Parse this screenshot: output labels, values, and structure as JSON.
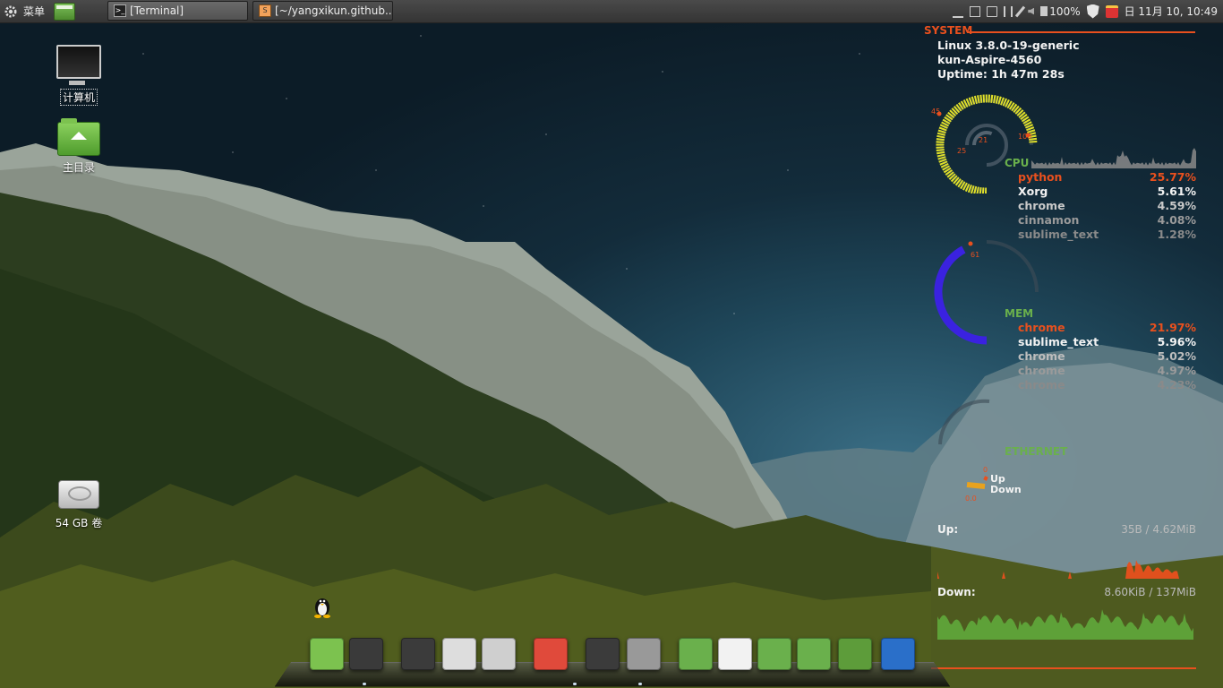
{
  "panel": {
    "menu_label": "菜单",
    "tasks": [
      {
        "title": "[Terminal]",
        "active": true
      },
      {
        "title": "[~/yangxikun.github..."
      }
    ],
    "battery": "100%",
    "clock": "日 11月 10, 10:49"
  },
  "desktop": {
    "icons": [
      {
        "label": "计算机",
        "icon": "computer-icon"
      },
      {
        "label": "主目录",
        "icon": "home-folder-icon"
      },
      {
        "label": "54 GB 卷",
        "icon": "drive-icon"
      }
    ]
  },
  "conky": {
    "system_title": "SYSTEM",
    "kernel": "Linux 3.8.0-19-generic",
    "hostname": "kun-Aspire-4560",
    "uptime": "Uptime: 1h 47m 28s",
    "cpu": {
      "label": "CPU",
      "gauge_labels": {
        "outer": "45",
        "outer_max": "100",
        "inner": "21",
        "inner2": "25"
      },
      "usage_outer": 0.45,
      "usage_inner": 0.21,
      "processes": [
        {
          "name": "python",
          "value": "25.77%"
        },
        {
          "name": "Xorg",
          "value": "5.61%"
        },
        {
          "name": "chrome",
          "value": "4.59%"
        },
        {
          "name": "cinnamon",
          "value": "4.08%"
        },
        {
          "name": "sublime_text",
          "value": "1.28%"
        }
      ]
    },
    "mem": {
      "label": "MEM",
      "gauge_label": "61",
      "usage": 0.61,
      "processes": [
        {
          "name": "chrome",
          "value": "21.97%"
        },
        {
          "name": "sublime_text",
          "value": "5.96%"
        },
        {
          "name": "chrome",
          "value": "5.02%"
        },
        {
          "name": "chrome",
          "value": "4.97%"
        },
        {
          "name": "chrome",
          "value": "4.23%"
        }
      ]
    },
    "ethernet": {
      "label": "ETHERNET",
      "up_label": "Up",
      "down_label": "Down",
      "up_small": "0",
      "down_small": "0.0",
      "up_title": "Up:",
      "up_value": "35B  / 4.62MiB",
      "down_title": "Down:",
      "down_value": "8.60KiB / 137MiB"
    }
  },
  "dock": {
    "items": [
      {
        "name": "linux-mint-menu-icon",
        "color": "#7cc24f"
      },
      {
        "name": "terminal-icon",
        "color": "#3a3a3a"
      },
      {
        "name": "sublime-text-icon",
        "color": "#3b3b3b"
      },
      {
        "name": "pidgin-icon",
        "color": "#dddddd"
      },
      {
        "name": "calculator-icon",
        "color": "#cfcfcf"
      },
      {
        "name": "chrome-icon",
        "color": "#e04a3b"
      },
      {
        "name": "sublime-text-icon",
        "color": "#3b3b3b"
      },
      {
        "name": "camera-icon",
        "color": "#999999"
      },
      {
        "name": "home-folder-icon",
        "color": "#6ab04c"
      },
      {
        "name": "documents-icon",
        "color": "#f2f2f2"
      },
      {
        "name": "backup-icon",
        "color": "#6ab04c"
      },
      {
        "name": "downloads-folder-icon",
        "color": "#6ab04c"
      },
      {
        "name": "show-desktop-icon",
        "color": "#5d9c3a"
      },
      {
        "name": "accessibility-icon",
        "color": "#2a6fc9"
      }
    ]
  }
}
